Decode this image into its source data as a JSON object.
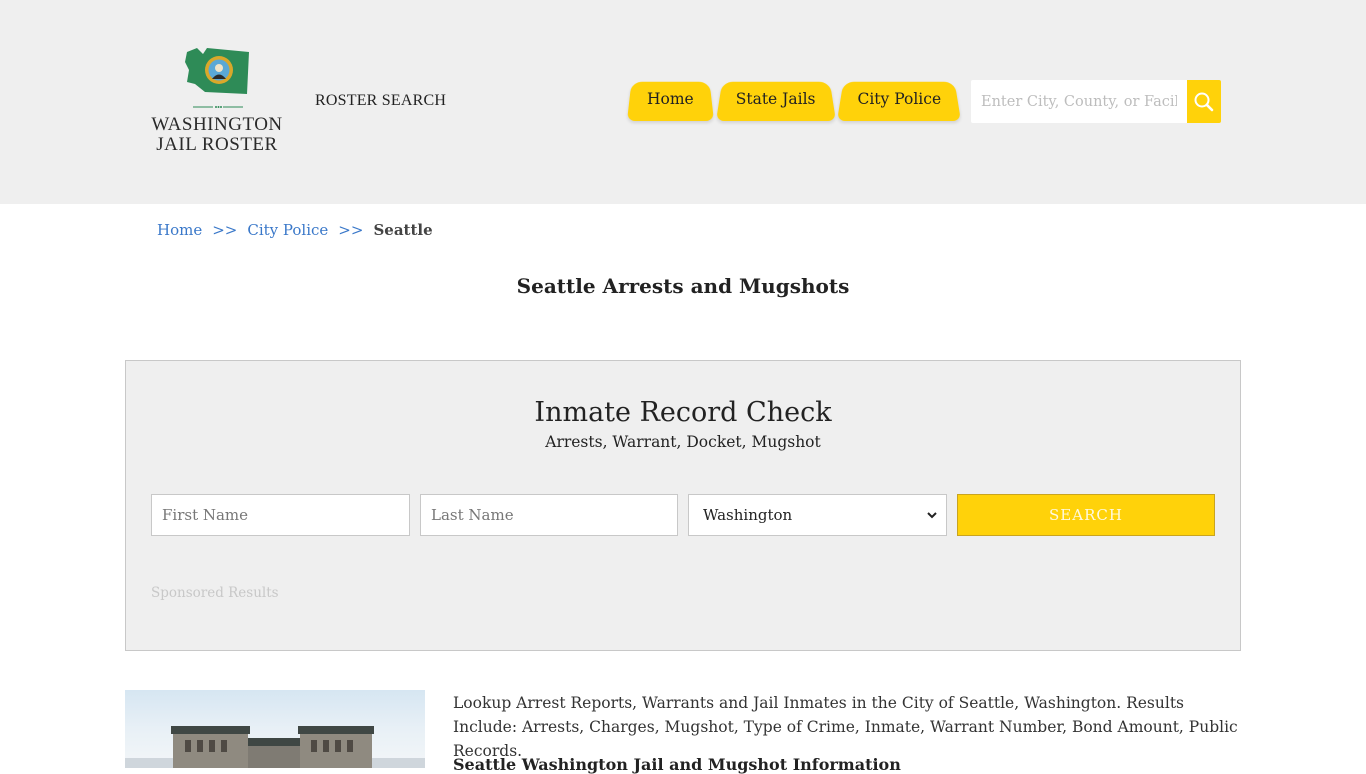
{
  "header": {
    "logo": {
      "line1": "WASHINGTON",
      "line2": "JAIL ROSTER",
      "map_color": "#2e8b57"
    },
    "roster_search": "ROSTER SEARCH",
    "nav": [
      {
        "label": "Home"
      },
      {
        "label": "State Jails"
      },
      {
        "label": "City Police"
      }
    ],
    "search": {
      "placeholder": "Enter City, County, or Facility",
      "icon": "search-icon"
    },
    "accent_color": "#ffd20a"
  },
  "breadcrumb": {
    "items": [
      {
        "label": "Home"
      },
      {
        "label": "City Police"
      }
    ],
    "separator": ">>",
    "current": "Seattle"
  },
  "page": {
    "title": "Seattle Arrests and Mugshots"
  },
  "record_check": {
    "title": "Inmate Record Check",
    "subtitle": "Arrests, Warrant, Docket, Mugshot",
    "first_name_placeholder": "First Name",
    "last_name_placeholder": "Last Name",
    "state_selected": "Washington",
    "search_label": "SEARCH",
    "sponsored": "Sponsored Results"
  },
  "content": {
    "intro": "Lookup Arrest Reports, Warrants and Jail Inmates in the City of Seattle, Washington. Results Include: Arrests, Charges, Mugshot, Type of Crime, Inmate, Warrant Number, Bond Amount, Public Records.",
    "heading": "Seattle Washington Jail and Mugshot Information"
  }
}
